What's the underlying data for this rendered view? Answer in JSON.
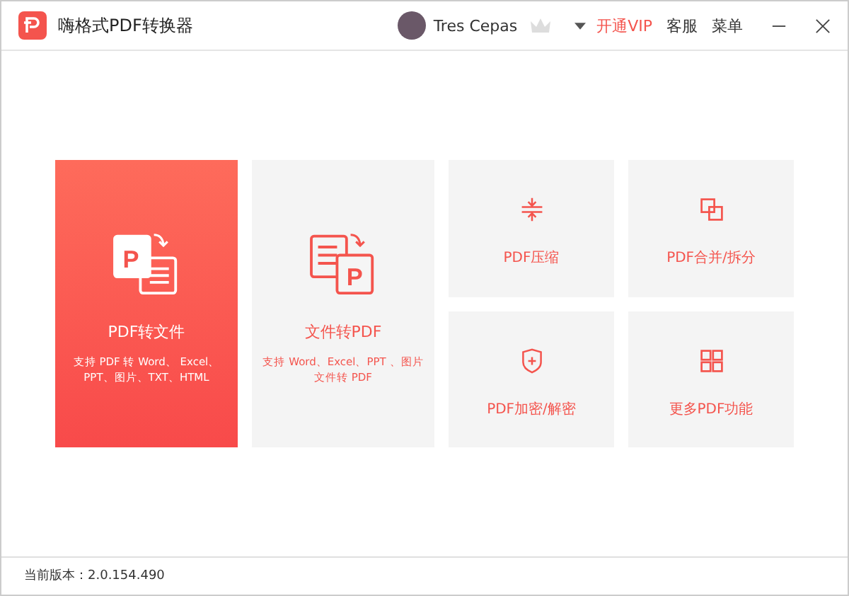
{
  "window": {
    "title": "嗨格式PDF转换器"
  },
  "header": {
    "user": "Tres Cepas",
    "vip": "开通VIP",
    "links": [
      "客服",
      "菜单"
    ]
  },
  "big_cards": [
    {
      "title": "PDF转文件",
      "icon_letter": "P",
      "description": "支持 PDF 转 Word、 Excel、PPT、图片、TXT、HTML",
      "selected": true
    },
    {
      "title": "文件转PDF",
      "icon_letter": "P",
      "description": "支持 Word、Excel、PPT 、图片文件转 PDF",
      "selected": false
    }
  ],
  "small_cards": [
    {
      "title": "PDF压缩"
    },
    {
      "title": "PDF合并/拆分"
    },
    {
      "title": "PDF加密/解密"
    },
    {
      "title": "更多PDF功能"
    }
  ],
  "status_bar": {
    "version": "当前版本：2.0.154.490"
  }
}
